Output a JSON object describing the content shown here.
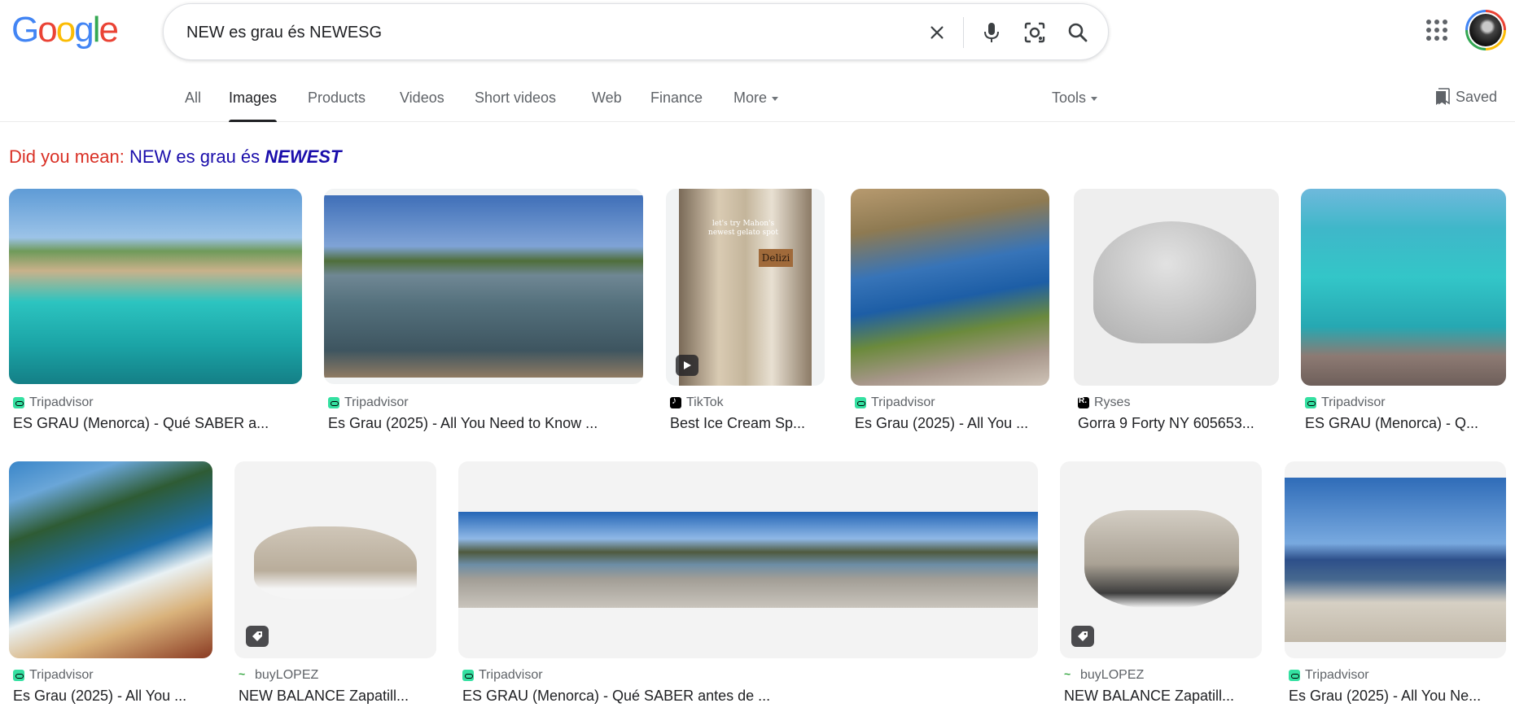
{
  "logo_text": "Google",
  "search": {
    "query": "NEW es grau és NEWESG"
  },
  "tabs": [
    {
      "label": "All",
      "active": false
    },
    {
      "label": "Images",
      "active": true
    },
    {
      "label": "Products",
      "active": false
    },
    {
      "label": "Videos",
      "active": false
    },
    {
      "label": "Short videos",
      "active": false
    },
    {
      "label": "Web",
      "active": false
    },
    {
      "label": "Finance",
      "active": false
    },
    {
      "label": "More",
      "active": false
    }
  ],
  "tools_label": "Tools",
  "saved_label": "Saved",
  "did_you_mean": {
    "label": "Did you mean:",
    "prefix": "NEW es grau és",
    "correction": "NEWEST"
  },
  "results": [
    {
      "source": "Tripadvisor",
      "title": "ES GRAU (Menorca) - Qué SABER a...",
      "icon": "tripadvisor"
    },
    {
      "source": "Tripadvisor",
      "title": "Es Grau (2025) - All You Need to Know ...",
      "icon": "tripadvisor"
    },
    {
      "source": "TikTok",
      "title": "Best Ice Cream Sp...",
      "icon": "tiktok",
      "overlay_lines": [
        "let's try Mahon's",
        "newest gelato spot"
      ],
      "shop_sign": "Delizi"
    },
    {
      "source": "Tripadvisor",
      "title": "Es Grau (2025) - All You ...",
      "icon": "tripadvisor"
    },
    {
      "source": "Ryses",
      "title": "Gorra 9 Forty NY 605653...",
      "icon": "ryses"
    },
    {
      "source": "Tripadvisor",
      "title": "ES GRAU (Menorca) - Q...",
      "icon": "tripadvisor"
    },
    {
      "source": "Tripadvisor",
      "title": "Es Grau (2025) - All You ...",
      "icon": "tripadvisor"
    },
    {
      "source": "buyLOPEZ",
      "title": "NEW BALANCE Zapatill...",
      "icon": "buylopez"
    },
    {
      "source": "Tripadvisor",
      "title": "ES GRAU (Menorca) - Qué SABER antes de ...",
      "icon": "tripadvisor"
    },
    {
      "source": "buyLOPEZ",
      "title": "NEW BALANCE Zapatill...",
      "icon": "buylopez"
    },
    {
      "source": "Tripadvisor",
      "title": "Es Grau (2025) - All You Ne...",
      "icon": "tripadvisor"
    }
  ],
  "colors": {
    "accent_blue": "#1a0dab",
    "did_you_mean_red": "#d93025",
    "text_secondary": "#5f6368"
  }
}
